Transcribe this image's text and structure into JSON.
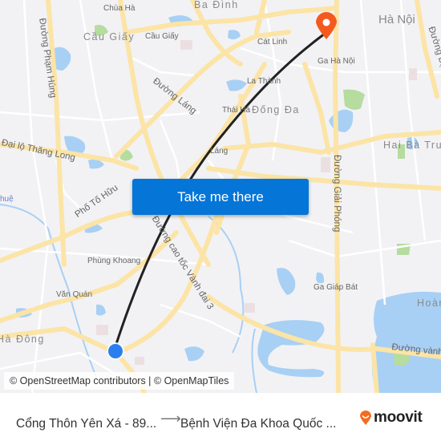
{
  "map": {
    "labels": {
      "chua_ha": "Chùa Hà",
      "ba_dinh": "Ba Đình",
      "ha_noi": "Hà Nội",
      "duong_pham_hung": "Đường Phạm Hùng",
      "cau_giay_district": "Cầu Giấy",
      "cau_giay": "Cầu Giấy",
      "cat_linh": "Cát Linh",
      "ga_ha_noi": "Ga Hà Nội",
      "duong_bach": "Đường Bạch",
      "la_thanh": "La Thành",
      "duong_lang": "Đường Láng",
      "thai_ha": "Thái Hà",
      "dong_da": "Đống Đa",
      "dai_lo_thang_long": "Đại lộ Thăng Long",
      "lang": "Láng",
      "hai_ba_trung": "Hai Bà Trưng",
      "hue": "huệ",
      "pho_to_huu": "Phố Tố Hữu",
      "duong_cao_toc": "Đường cao tốc Vành đai 3",
      "duong_giai_phong": "Đường Giải Phóng",
      "phung_khoang": "Phùng Khoang",
      "ga_giap_bat": "Ga Giáp Bát",
      "van_quan": "Văn Quán",
      "hoang": "Hoàn",
      "ha_dong": "Hà Đông",
      "duong_vanh": "Đường vành"
    },
    "route": {
      "line_color": "#222222",
      "origin_marker_color": "#2a7ff0",
      "destination_marker_color": "#f45a1f"
    },
    "attribution": "© OpenStreetMap contributors | © OpenMapTiles"
  },
  "actions": {
    "take_me_there": "Take me there"
  },
  "footer": {
    "from": "Cổng Thôn Yên Xá - 89...",
    "arrow": "⟶",
    "to": "Bệnh Viện Đa Khoa Quốc ...",
    "brand": "moovit",
    "brand_color": "#f46b1f"
  }
}
